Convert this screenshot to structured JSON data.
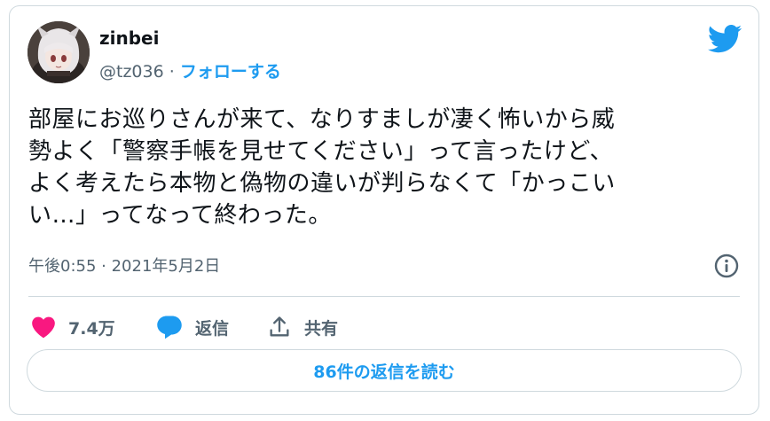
{
  "user": {
    "display_name": "zinbei",
    "handle": "@tz036",
    "separator": " · ",
    "follow_label": "フォローする"
  },
  "tweet": {
    "lines": [
      "部屋にお巡りさんが来て、なりすましが凄く怖いから威",
      "勢よく「警察手帳を見せてください」って言ったけど、",
      "よく考えたら本物と偽物の違いが判らなくて「かっこい",
      "い…」ってなって終わった。"
    ],
    "timestamp": "午後0:55 · 2021年5月2日"
  },
  "actions": {
    "like_count": "7.4万",
    "reply_label": "返信",
    "share_label": "共有"
  },
  "read_replies_label": "86件の返信を読む",
  "icons": {
    "brand": "twitter-bird-icon",
    "like": "heart-icon",
    "reply": "speech-bubble-icon",
    "share": "share-icon",
    "info": "info-icon"
  },
  "colors": {
    "accent": "#1d9bf0",
    "like": "#f91880",
    "text": "#0f1419",
    "secondary": "#536471",
    "border": "#cfd9de"
  }
}
